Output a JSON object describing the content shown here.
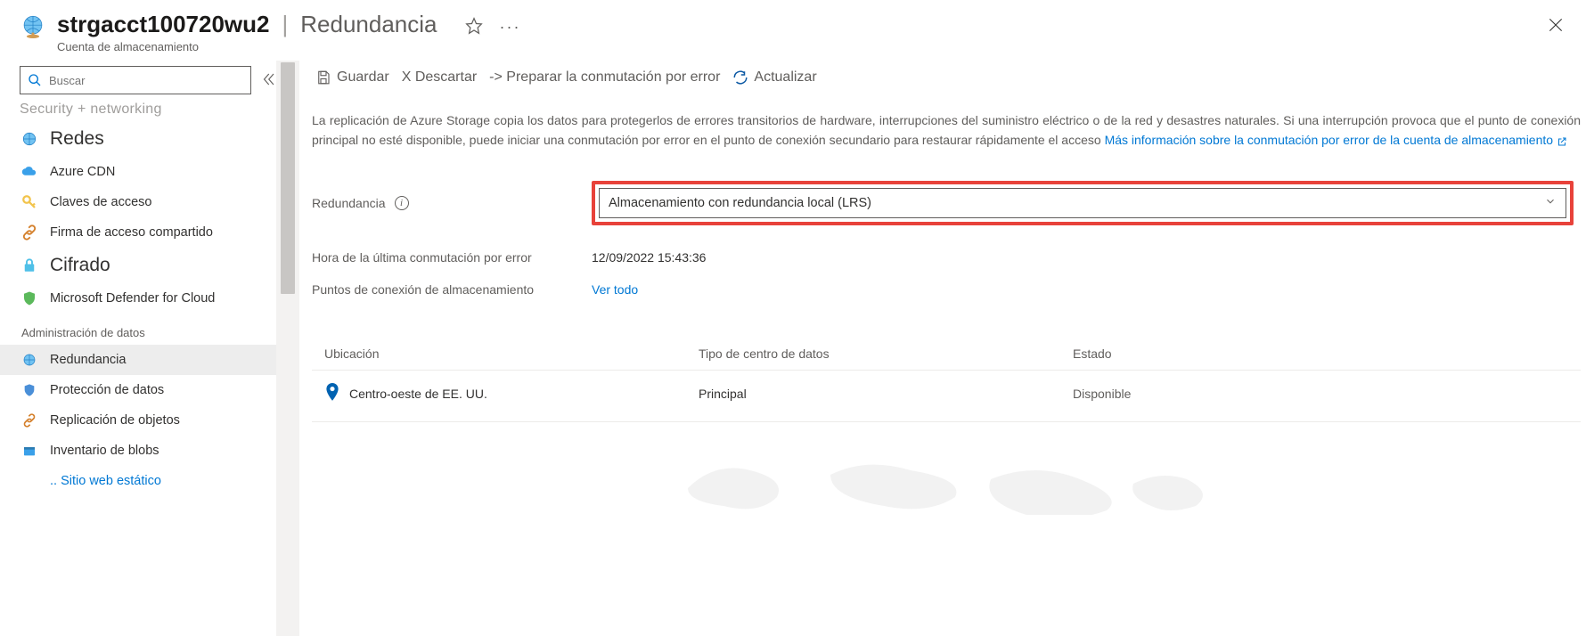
{
  "header": {
    "resource_name": "strgacct100720wu2",
    "separator": "|",
    "page_title": "Redundancia",
    "subtitle": "Cuenta de almacenamiento"
  },
  "search": {
    "placeholder": "Buscar"
  },
  "sidebar": {
    "truncated_top": "Security + networking",
    "items": [
      {
        "label": "Redes",
        "icon": "globe",
        "big": true
      },
      {
        "label": "Azure CDN",
        "icon": "cloud"
      },
      {
        "label": "Claves de acceso",
        "icon": "key"
      },
      {
        "label": "Firma de acceso compartido",
        "icon": "link"
      },
      {
        "label": "Cifrado",
        "icon": "lock",
        "big": true
      },
      {
        "label": "Microsoft Defender for Cloud",
        "icon": "shield"
      }
    ],
    "section": "Administración de datos",
    "items2": [
      {
        "label": "Redundancia",
        "icon": "globe-small",
        "selected": true
      },
      {
        "label": "Protección de datos",
        "icon": "shield-blue"
      },
      {
        "label": "Replicación de objetos",
        "icon": "link"
      },
      {
        "label": "Inventario de blobs",
        "icon": "box"
      },
      {
        "label": ".. Sitio web estático",
        "icon": "none"
      }
    ]
  },
  "toolbar": {
    "save": "Guardar",
    "discard": "X Descartar",
    "prepare": "-> Preparar la conmutación por error",
    "refresh": "Actualizar"
  },
  "description": {
    "line1": "La replicación de Azure Storage copia los datos para protegerlos de errores transitorios de hardware, interrupciones del suministro eléctrico o de la red y desastres naturales. Si una interrupción",
    "line2": "provoca que el punto de conexión principal no esté disponible, puede iniciar una conmutación por error en el punto de conexión secundario para restaurar rápidamente el acceso",
    "link": "Más información sobre la conmutación por error de la cuenta de almacenamiento"
  },
  "form": {
    "redundancy_label": "Redundancia",
    "redundancy_value": "Almacenamiento con redundancia local (LRS)",
    "last_failover_label": "Hora de la última conmutación por error",
    "last_failover_value": "12/09/2022 15:43:36",
    "endpoints_label": "Puntos de conexión de almacenamiento",
    "endpoints_link": "Ver todo"
  },
  "table": {
    "head_location": "Ubicación",
    "head_type": "Tipo de centro de datos",
    "head_status": "Estado",
    "rows": [
      {
        "location": "Centro-oeste de EE. UU.",
        "type": "Principal",
        "status": "Disponible"
      }
    ]
  }
}
